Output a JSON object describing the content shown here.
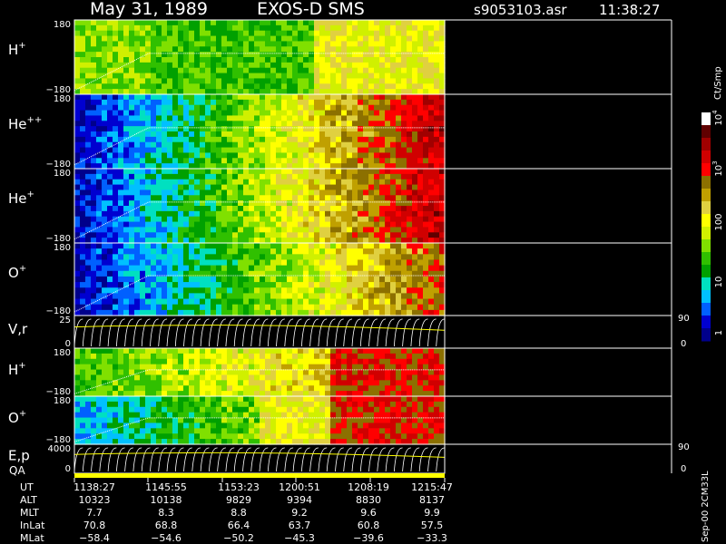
{
  "header": {
    "date": "May 31, 1989",
    "instrument": "EXOS-D SMS",
    "file": "s9053103.asr",
    "time": "11:38:27"
  },
  "colorbar": {
    "label": "Ct/Smp",
    "tick_labels": [
      "1",
      "10",
      "100",
      "10",
      "10"
    ],
    "tick_exponents": [
      "",
      "",
      "",
      "3",
      "4"
    ],
    "colors": [
      "#00008b",
      "#0000d0",
      "#0060ff",
      "#00c0ff",
      "#00e0c0",
      "#00a000",
      "#30c000",
      "#80e000",
      "#d0f000",
      "#ffff00",
      "#e0d040",
      "#c0a000",
      "#8c7000",
      "#ff0000",
      "#d00000",
      "#a00000",
      "#600000",
      "#ffffff"
    ]
  },
  "panels": [
    {
      "species": "H",
      "superscript": "+",
      "ymax": "180",
      "ymin": "−180"
    },
    {
      "species": "He",
      "superscript": "++",
      "ymax": "180",
      "ymin": "−180"
    },
    {
      "species": "He",
      "superscript": "+",
      "ymax": "180",
      "ymin": "−180"
    },
    {
      "species": "O",
      "superscript": "+",
      "ymax": "180",
      "ymin": "−180"
    },
    {
      "species": "V,r",
      "superscript": "",
      "ymax": "25",
      "ymin": "0",
      "right_top": "90",
      "right_bottom": "0"
    },
    {
      "species": "H",
      "superscript": "+",
      "ymax": "180",
      "ymin": "−180"
    },
    {
      "species": "O",
      "superscript": "+",
      "ymax": "180",
      "ymin": "−180"
    },
    {
      "species": "E,p",
      "superscript": "",
      "ymax": "4000",
      "ymin": "0",
      "right_top": "90",
      "right_bottom": "0"
    }
  ],
  "qa_label": "QA",
  "side_label": "Sep-00 2CM33L",
  "ephemeris": {
    "rows": [
      {
        "name": "UT",
        "values": [
          "1138:27",
          "1145:55",
          "1153:23",
          "1200:51",
          "1208:19",
          "1215:47"
        ]
      },
      {
        "name": "ALT",
        "values": [
          "10323",
          "10138",
          "9829",
          "9394",
          "8830",
          "8137"
        ]
      },
      {
        "name": "MLT",
        "values": [
          "7.7",
          "8.3",
          "8.8",
          "9.2",
          "9.6",
          "9.9"
        ]
      },
      {
        "name": "InLat",
        "values": [
          "70.8",
          "68.8",
          "66.4",
          "63.7",
          "60.8",
          "57.5"
        ]
      },
      {
        "name": "MLat",
        "values": [
          "−58.4",
          "−54.6",
          "−50.2",
          "−45.3",
          "−39.6",
          "−33.3"
        ]
      }
    ]
  },
  "chart_data": {
    "type": "heatmap",
    "title": "May 31, 1989   EXOS-D SMS",
    "x": [
      "1138:27",
      "1145:55",
      "1153:23",
      "1200:51",
      "1208:19",
      "1215:47"
    ],
    "colorbar_label": "Ct/Smp",
    "colorbar_range": [
      1,
      10000
    ],
    "colorbar_scale": "log",
    "series": [
      {
        "name": "H+",
        "ylim": [
          -180,
          180
        ]
      },
      {
        "name": "He++",
        "ylim": [
          -180,
          180
        ]
      },
      {
        "name": "He+",
        "ylim": [
          -180,
          180
        ]
      },
      {
        "name": "O+",
        "ylim": [
          -180,
          180
        ]
      },
      {
        "name": "V,r",
        "ylim": [
          0,
          25
        ]
      },
      {
        "name": "H+",
        "ylim": [
          -180,
          180
        ]
      },
      {
        "name": "O+",
        "ylim": [
          -180,
          180
        ]
      },
      {
        "name": "E,p",
        "ylim": [
          0,
          4000
        ]
      }
    ]
  }
}
